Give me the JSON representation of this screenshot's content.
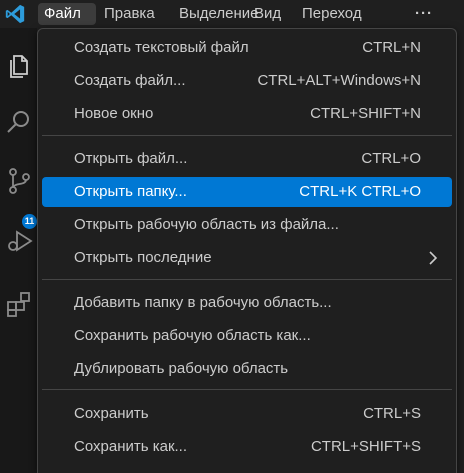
{
  "menubar": {
    "logo_icon": "vscode-logo-icon",
    "items": [
      {
        "label": "Файл",
        "active": true
      },
      {
        "label": "Правка"
      },
      {
        "label": "Выделение"
      },
      {
        "label": "Вид"
      },
      {
        "label": "Переход"
      },
      {
        "label": "···"
      }
    ]
  },
  "activitybar": {
    "icons": [
      "explorer-icon",
      "search-icon",
      "source-control-icon",
      "run-debug-icon",
      "extensions-icon"
    ],
    "source_control_badge": "11"
  },
  "file_menu": {
    "groups": [
      [
        {
          "label": "Создать текстовый файл",
          "shortcut": "CTRL+N"
        },
        {
          "label": "Создать файл...",
          "shortcut": "CTRL+ALT+Windows+N"
        },
        {
          "label": "Новое окно",
          "shortcut": "CTRL+SHIFT+N"
        }
      ],
      [
        {
          "label": "Открыть файл...",
          "shortcut": "CTRL+O"
        },
        {
          "label": "Открыть папку...",
          "shortcut": "CTRL+K CTRL+O",
          "highlighted": true
        },
        {
          "label": "Открыть рабочую область из файла...",
          "shortcut": ""
        },
        {
          "label": "Открыть последние",
          "shortcut": "",
          "submenu_icon": "chevron-right-icon"
        }
      ],
      [
        {
          "label": "Добавить папку в рабочую область...",
          "shortcut": ""
        },
        {
          "label": "Сохранить рабочую область как...",
          "shortcut": ""
        },
        {
          "label": "Дублировать рабочую область",
          "shortcut": ""
        }
      ],
      [
        {
          "label": "Сохранить",
          "shortcut": "CTRL+S"
        },
        {
          "label": "Сохранить как...",
          "shortcut": "CTRL+SHIFT+S"
        }
      ]
    ]
  },
  "colors": {
    "accent": "#0078d4",
    "menu_bg": "#1f1f1f",
    "border": "#454545",
    "text": "#cccccc"
  }
}
